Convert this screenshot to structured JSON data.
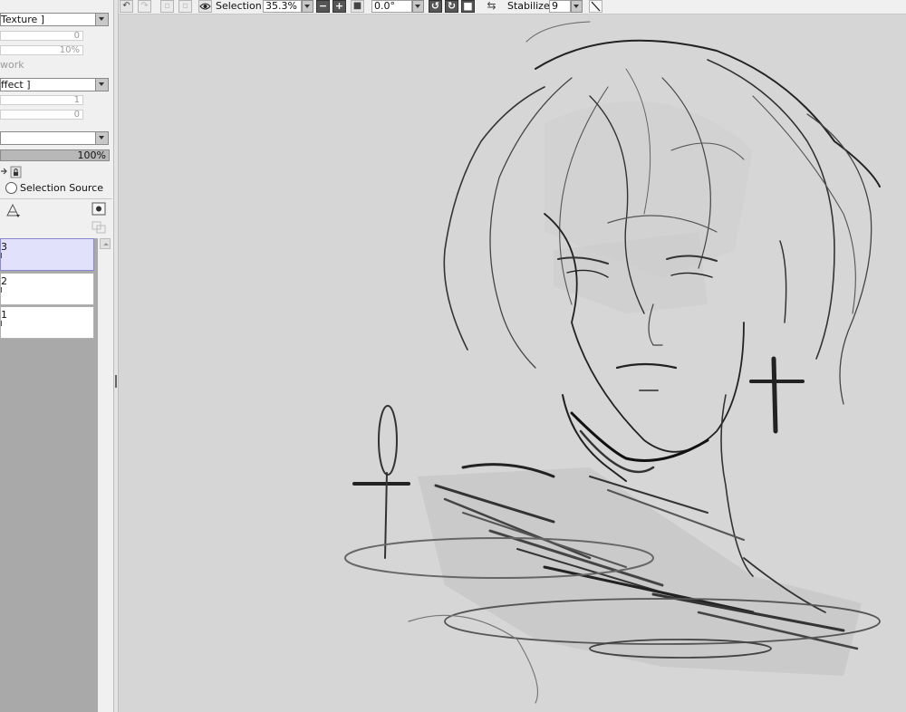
{
  "left_panel": {
    "texture_combo": "Texture ]",
    "texture_slider_1": "0",
    "texture_slider_2": "10%",
    "work_label": "work",
    "effect_combo": "ffect ]",
    "effect_slider_1": "1",
    "effect_slider_2": "0",
    "blend_combo": "",
    "opacity_value": "100%",
    "selection_source_label": "Selection Source",
    "layers": [
      {
        "name": "3",
        "active": true
      },
      {
        "name": "2",
        "active": false
      },
      {
        "name": "1",
        "active": false
      }
    ]
  },
  "toolbar": {
    "undo_icon": "undo-icon",
    "redo_icon": "redo-icon",
    "selection_label": "Selection",
    "zoom_value": "35.3%",
    "rotation_value": "0.0°",
    "stabilizer_label": "Stabilizer",
    "stabilizer_value": "9"
  },
  "canvas": {
    "background_color": "#d6d6d6",
    "artwork": "sketch"
  }
}
